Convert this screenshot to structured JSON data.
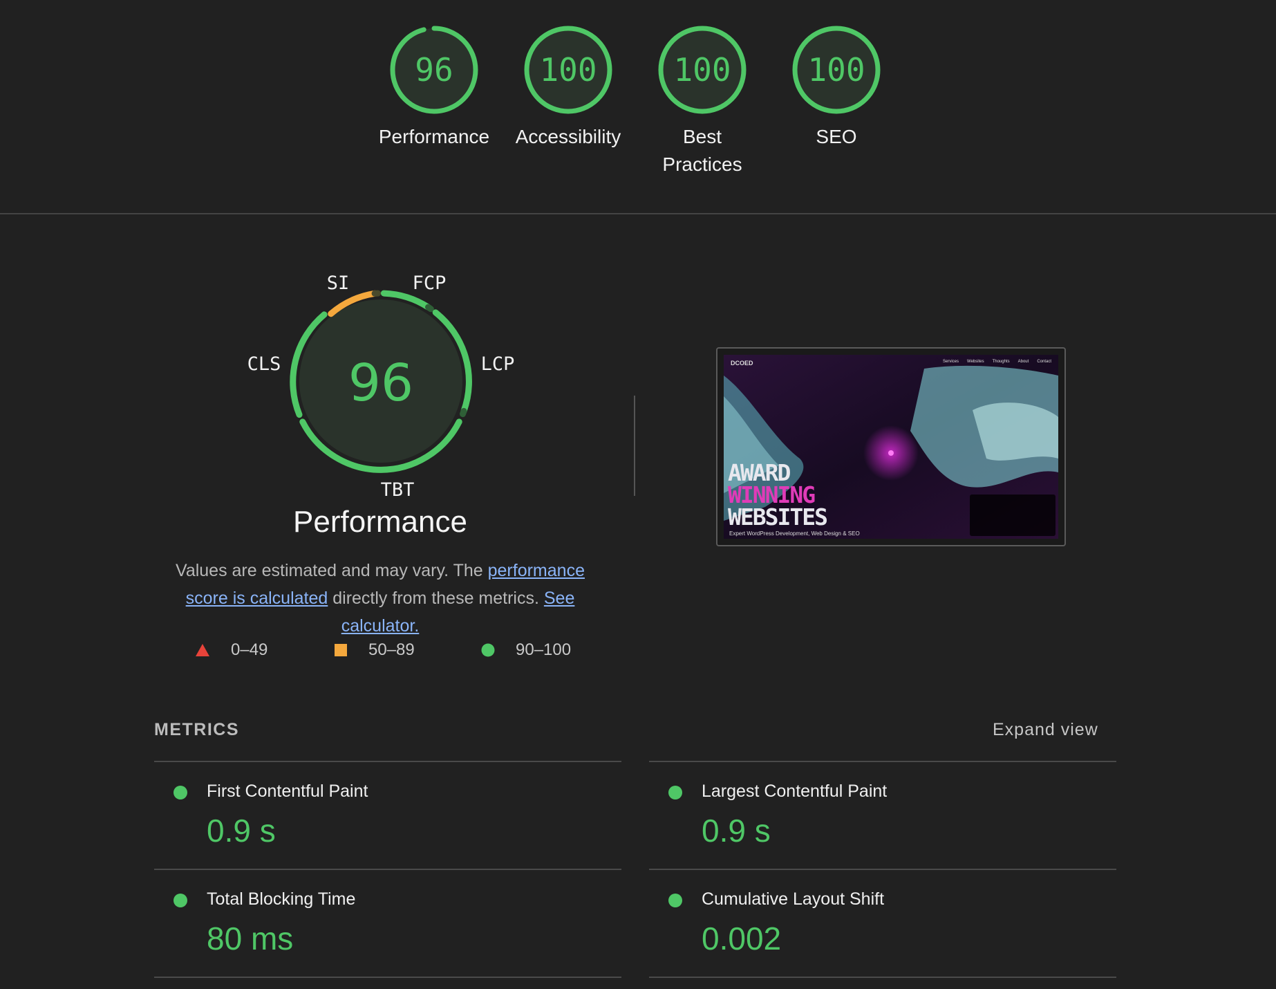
{
  "scores": [
    {
      "value": "96",
      "label": "Performance"
    },
    {
      "value": "100",
      "label": "Accessibility"
    },
    {
      "value": "100",
      "label": "Best Practices"
    },
    {
      "value": "100",
      "label": "SEO"
    }
  ],
  "performance": {
    "score": "96",
    "title": "Performance",
    "metric_labels": {
      "si": "SI",
      "fcp": "FCP",
      "lcp": "LCP",
      "tbt": "TBT",
      "cls": "CLS"
    },
    "description_pre": "Values are estimated and may vary. The ",
    "description_link1": "performance score is calculated",
    "description_mid": " directly from these metrics. ",
    "description_link2": "See calculator."
  },
  "legend": [
    {
      "icon": "triangle-icon",
      "label": "0–49",
      "color": "#e8433a"
    },
    {
      "icon": "square-icon",
      "label": "50–89",
      "color": "#f4a83d"
    },
    {
      "icon": "circle-icon",
      "label": "90–100",
      "color": "#4fc766"
    }
  ],
  "screenshot": {
    "logo": "DCOED",
    "nav": [
      "Services",
      "Websites",
      "Thoughts",
      "About",
      "Contact"
    ],
    "hero_line1": "AWARD",
    "hero_line2": "WINNING",
    "hero_line3": "WEBSITES",
    "hero_sub": "Expert WordPress Development, Web Design & SEO"
  },
  "metrics": {
    "header": "METRICS",
    "expand_label": "Expand view",
    "items": [
      {
        "name": "First Contentful Paint",
        "value": "0.9 s"
      },
      {
        "name": "Largest Contentful Paint",
        "value": "0.9 s"
      },
      {
        "name": "Total Blocking Time",
        "value": "80 ms"
      },
      {
        "name": "Cumulative Layout Shift",
        "value": "0.002"
      }
    ]
  },
  "colors": {
    "pass": "#4fc766",
    "average": "#f4a83d",
    "fail": "#e8433a",
    "link": "#8ab4f8"
  }
}
